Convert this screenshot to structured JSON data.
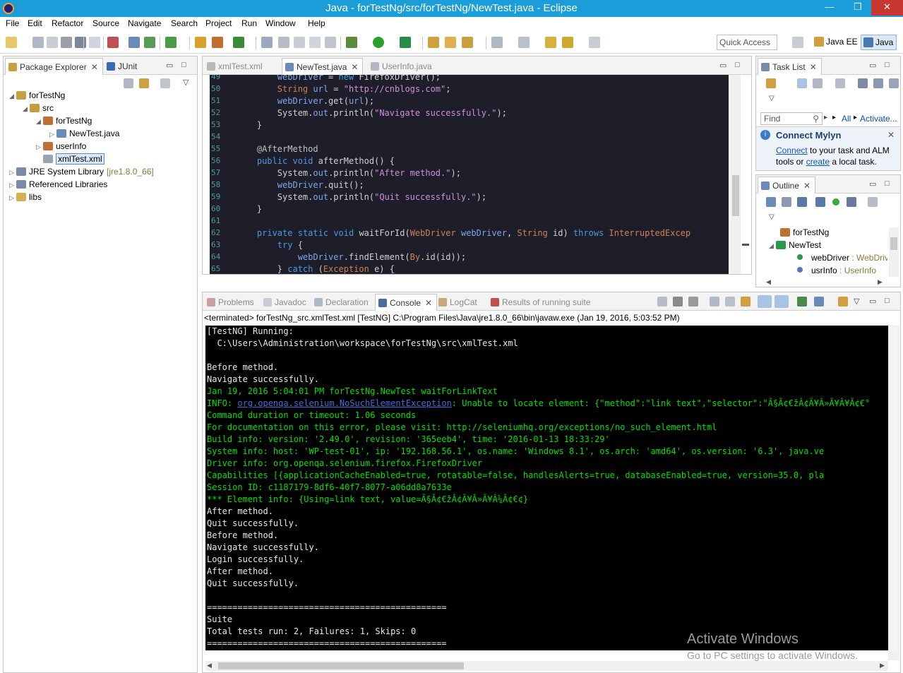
{
  "window": {
    "title": "Java - forTestNg/src/forTestNg/NewTest.java - Eclipse",
    "minimize": "—",
    "restore": "❐",
    "close": "✕"
  },
  "menu": [
    "File",
    "Edit",
    "Refactor",
    "Source",
    "Navigate",
    "Search",
    "Project",
    "Run",
    "Window",
    "Help"
  ],
  "toolbar": {
    "quick_access": "Quick Access",
    "perspectives": [
      "Java EE",
      "Java"
    ]
  },
  "package_explorer": {
    "tabs": [
      "Package Explorer",
      "JUnit"
    ],
    "tree": [
      {
        "label": "forTestNg",
        "decor": "",
        "level": 0,
        "twisty": "◢",
        "icon": "project-icon"
      },
      {
        "label": "src",
        "decor": "",
        "level": 1,
        "twisty": "◢",
        "icon": "source-folder-icon"
      },
      {
        "label": "forTestNg",
        "decor": "",
        "level": 2,
        "twisty": "◢",
        "icon": "package-icon"
      },
      {
        "label": "NewTest.java",
        "decor": "",
        "level": 3,
        "twisty": "▷",
        "icon": "java-file-icon"
      },
      {
        "label": "userInfo",
        "decor": "",
        "level": 2,
        "twisty": "▷",
        "icon": "package-icon"
      },
      {
        "label": "xmlTest.xml",
        "decor": "",
        "level": 2,
        "twisty": "",
        "icon": "xml-file-icon"
      },
      {
        "label": "JRE System Library",
        "decor": "[jre1.8.0_66]",
        "level": 0,
        "twisty": "▷",
        "icon": "library-icon"
      },
      {
        "label": "Referenced Libraries",
        "decor": "",
        "level": 0,
        "twisty": "▷",
        "icon": "library-icon"
      },
      {
        "label": "libs",
        "decor": "",
        "level": 0,
        "twisty": "▷",
        "icon": "folder-icon"
      }
    ]
  },
  "editor": {
    "tabs": [
      "xmlTest.xml",
      "NewTest.java",
      "UserInfo.java"
    ],
    "line_numbers": [
      "49",
      "50",
      "51",
      "52",
      "53",
      "54",
      "55",
      "56",
      "57",
      "58",
      "59",
      "60",
      "61",
      "62",
      "63",
      "64",
      "65"
    ],
    "lines": [
      "        webDriver = new FirefoxDriver();",
      "        String url = \"http://cnblogs.com\";",
      "        webDriver.get(url);",
      "        System.out.println(\"Navigate successfully.\");",
      "    }",
      "",
      "    @AfterMethod",
      "    public void afterMethod() {",
      "        System.out.println(\"After method.\");",
      "        webDriver.quit();",
      "        System.out.println(\"Quit successfully.\");",
      "    }",
      "",
      "    private static void waitForId(WebDriver webDriver, String id) throws InterruptedExcep",
      "        try {",
      "            webDriver.findElement(By.id(id));",
      "        } catch (Exception e) {"
    ]
  },
  "task_list": {
    "tab": "Task List",
    "find_placeholder": "Find",
    "all": "All",
    "activate": "Activate...",
    "mylyn_title": "Connect Mylyn",
    "mylyn_connect": "Connect",
    "mylyn_text1": " to your task and ALM",
    "mylyn_text2": "tools or ",
    "mylyn_create": "create",
    "mylyn_text3": " a local task."
  },
  "outline": {
    "tab": "Outline",
    "items": [
      {
        "label": "forTestNg",
        "type": ""
      },
      {
        "label": "NewTest",
        "type": ""
      },
      {
        "label": "webDriver",
        "type": " : WebDriver"
      },
      {
        "label": "usrInfo",
        "type": " : UserInfo"
      }
    ]
  },
  "console": {
    "tabs": [
      "Problems",
      "Javadoc",
      "Declaration",
      "Console",
      "LogCat",
      "Results of running suite"
    ],
    "status": "<terminated> forTestNg_src.xmlTest.xml [TestNG] C:\\Program Files\\Java\\jre1.8.0_66\\bin\\javaw.exe (Jan 19, 2016, 5:03:52 PM)",
    "lines": [
      {
        "text": "[TestNG] Running:",
        "green": false
      },
      {
        "text": "  C:\\Users\\Administration\\workspace\\forTestNg\\src\\xmlTest.xml",
        "green": false
      },
      {
        "text": "",
        "green": false
      },
      {
        "text": "Before method.",
        "green": false
      },
      {
        "text": "Navigate successfully.",
        "green": false
      },
      {
        "text": "Jan 19, 2016 5:04:01 PM forTestNg.NewTest waitForLinkText",
        "green": true
      },
      {
        "text": "INFO: ",
        "link": "org.openqa.selenium.NoSuchElementException",
        "rest": ": Unable to locate element: {\"method\":\"link text\",\"selector\":\"Ã§Ã¢€žÂ¢Ã¥Â»Ã¥Â¥Ã¢€°",
        "green": true
      },
      {
        "text": "Command duration or timeout: 1.06 seconds",
        "green": true
      },
      {
        "text": "For documentation on this error, please visit: http://seleniumhq.org/exceptions/no_such_element.html",
        "green": true
      },
      {
        "text": "Build info: version: '2.49.0', revision: '365eeb4', time: '2016-01-13 18:33:29'",
        "green": true
      },
      {
        "text": "System info: host: 'WP-test-01', ip: '192.168.56.1', os.name: 'Windows 8.1', os.arch: 'amd64', os.version: '6.3', java.ve",
        "green": true
      },
      {
        "text": "Driver info: org.openqa.selenium.firefox.FirefoxDriver",
        "green": true
      },
      {
        "text": "Capabilities [{applicationCacheEnabled=true, rotatable=false, handlesAlerts=true, databaseEnabled=true, version=35.0, pla",
        "green": true
      },
      {
        "text": "Session ID: c1187179-8df6-40f7-8077-a06dd8a7633e",
        "green": true
      },
      {
        "text": "*** Element info: {Using=link text, value=Ã§Ã¢€žÂ¢Ã¥Â»Ã¥Â¼Ã¢€¢}",
        "green": true
      },
      {
        "text": "After method.",
        "green": false
      },
      {
        "text": "Quit successfully.",
        "green": false
      },
      {
        "text": "Before method.",
        "green": false
      },
      {
        "text": "Navigate successfully.",
        "green": false
      },
      {
        "text": "Login successfully.",
        "green": false
      },
      {
        "text": "After method.",
        "green": false
      },
      {
        "text": "Quit successfully.",
        "green": false
      },
      {
        "text": "",
        "green": false
      },
      {
        "text": "===============================================",
        "green": false
      },
      {
        "text": "Suite",
        "green": false
      },
      {
        "text": "Total tests run: 2, Failures: 1, Skips: 0",
        "green": false
      },
      {
        "text": "===============================================",
        "green": false
      }
    ]
  },
  "watermark": {
    "title": "Activate Windows",
    "subtitle": "Go to PC settings to activate Windows."
  },
  "colors": {
    "titlebar": "#1b9dd9",
    "editor_bg": "#1e1e2a",
    "console_bg": "#000000",
    "console_green": "#00e000"
  }
}
